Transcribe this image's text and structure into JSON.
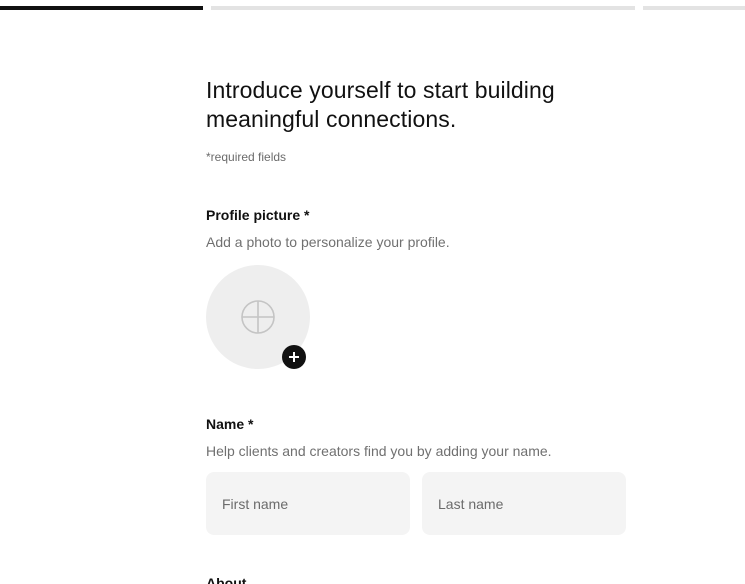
{
  "progress": {
    "total_steps": 3,
    "current_step": 1
  },
  "form": {
    "heading": "Introduce yourself to start building meaningful connections.",
    "required_note": "*required fields",
    "profile_picture": {
      "title": "Profile picture *",
      "help": "Add a photo to personalize your profile.",
      "placeholder_icon": "crosshair-icon",
      "add_icon": "plus-icon"
    },
    "name": {
      "title": "Name *",
      "help": "Help clients and creators find you by adding your name.",
      "first_name": {
        "placeholder": "First name",
        "value": ""
      },
      "last_name": {
        "placeholder": "Last name",
        "value": ""
      }
    },
    "about": {
      "title": "About"
    }
  },
  "colors": {
    "text": "#111111",
    "muted": "#707070",
    "progress_active": "#111111",
    "progress_inactive": "#e3e3e3",
    "input_bg": "#f4f4f4",
    "avatar_bg": "#eeeeee"
  }
}
